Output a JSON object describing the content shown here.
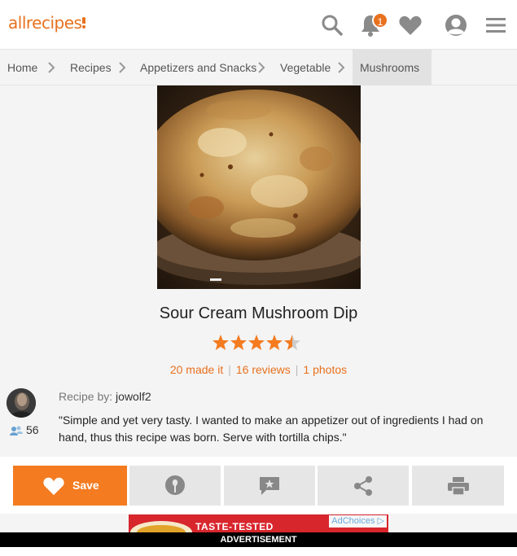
{
  "header": {
    "logo": "allrecipes",
    "notification_count": "1",
    "icons": [
      "search-icon",
      "bell-icon",
      "heart-icon",
      "profile-icon",
      "menu-icon"
    ]
  },
  "breadcrumb": [
    "Home",
    "Recipes",
    "Appetizers and Snacks",
    "Vegetable",
    "Mushrooms"
  ],
  "recipe": {
    "title": "Sour Cream Mushroom Dip",
    "rating": 4.5,
    "rating_max": 5,
    "made_it": "20 made it",
    "reviews": "16 reviews",
    "photos": "1 photos",
    "author_prefix": "Recipe by:",
    "author": "jowolf2",
    "followers": "56",
    "description": "\"Simple and yet very tasty. I wanted to make an appetizer out of ingredients I had on hand, thus this recipe was born. Serve with tortilla chips.\""
  },
  "actions": {
    "save_label": "Save",
    "icons": [
      "heart-icon",
      "made-it-icon",
      "review-icon",
      "share-icon",
      "print-icon"
    ]
  },
  "ad": {
    "headline": "TASTE-TESTED",
    "adchoices": "AdChoices",
    "label": "ADVERTISEMENT"
  },
  "colors": {
    "brand": "#e8711e",
    "save_button": "#f47b20"
  }
}
